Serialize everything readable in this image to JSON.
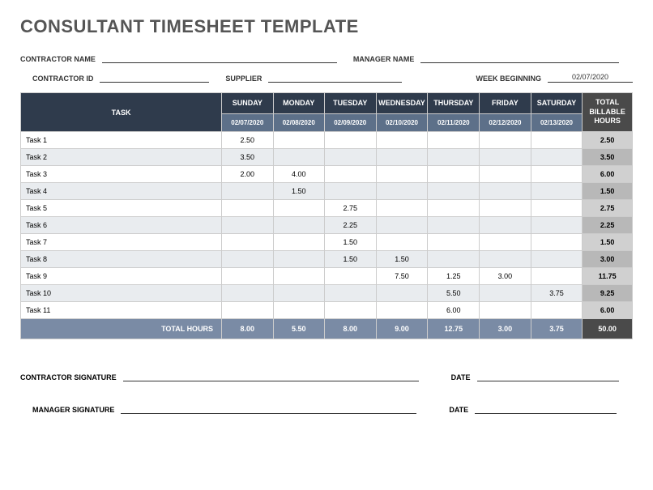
{
  "title": "CONSULTANT TIMESHEET TEMPLATE",
  "labels": {
    "contractor_name": "CONTRACTOR NAME",
    "manager_name": "MANAGER NAME",
    "contractor_id": "CONTRACTOR ID",
    "supplier": "SUPPLIER",
    "week_beginning": "WEEK BEGINNING",
    "task": "TASK",
    "total_billable": "TOTAL BILLABLE HOURS",
    "total_hours": "TOTAL HOURS",
    "contractor_signature": "CONTRACTOR SIGNATURE",
    "manager_signature": "MANAGER SIGNATURE",
    "date": "DATE"
  },
  "week_beginning_value": "02/07/2020",
  "days": [
    {
      "name": "SUNDAY",
      "date": "02/07/2020"
    },
    {
      "name": "MONDAY",
      "date": "02/08/2020"
    },
    {
      "name": "TUESDAY",
      "date": "02/09/2020"
    },
    {
      "name": "WEDNESDAY",
      "date": "02/10/2020"
    },
    {
      "name": "THURSDAY",
      "date": "02/11/2020"
    },
    {
      "name": "FRIDAY",
      "date": "02/12/2020"
    },
    {
      "name": "SATURDAY",
      "date": "02/13/2020"
    }
  ],
  "tasks": [
    {
      "name": "Task 1",
      "hours": [
        "2.50",
        "",
        "",
        "",
        "",
        "",
        ""
      ],
      "total": "2.50"
    },
    {
      "name": "Task 2",
      "hours": [
        "3.50",
        "",
        "",
        "",
        "",
        "",
        ""
      ],
      "total": "3.50"
    },
    {
      "name": "Task 3",
      "hours": [
        "2.00",
        "4.00",
        "",
        "",
        "",
        "",
        ""
      ],
      "total": "6.00"
    },
    {
      "name": "Task 4",
      "hours": [
        "",
        "1.50",
        "",
        "",
        "",
        "",
        ""
      ],
      "total": "1.50"
    },
    {
      "name": "Task 5",
      "hours": [
        "",
        "",
        "2.75",
        "",
        "",
        "",
        ""
      ],
      "total": "2.75"
    },
    {
      "name": "Task 6",
      "hours": [
        "",
        "",
        "2.25",
        "",
        "",
        "",
        ""
      ],
      "total": "2.25"
    },
    {
      "name": "Task 7",
      "hours": [
        "",
        "",
        "1.50",
        "",
        "",
        "",
        ""
      ],
      "total": "1.50"
    },
    {
      "name": "Task 8",
      "hours": [
        "",
        "",
        "1.50",
        "1.50",
        "",
        "",
        ""
      ],
      "total": "3.00"
    },
    {
      "name": "Task 9",
      "hours": [
        "",
        "",
        "",
        "7.50",
        "1.25",
        "3.00",
        ""
      ],
      "total": "11.75"
    },
    {
      "name": "Task 10",
      "hours": [
        "",
        "",
        "",
        "",
        "5.50",
        "",
        "3.75"
      ],
      "total": "9.25"
    },
    {
      "name": "Task 11",
      "hours": [
        "",
        "",
        "",
        "",
        "6.00",
        "",
        ""
      ],
      "total": "6.00"
    }
  ],
  "day_totals": [
    "8.00",
    "5.50",
    "8.00",
    "9.00",
    "12.75",
    "3.00",
    "3.75"
  ],
  "grand_total": "50.00"
}
